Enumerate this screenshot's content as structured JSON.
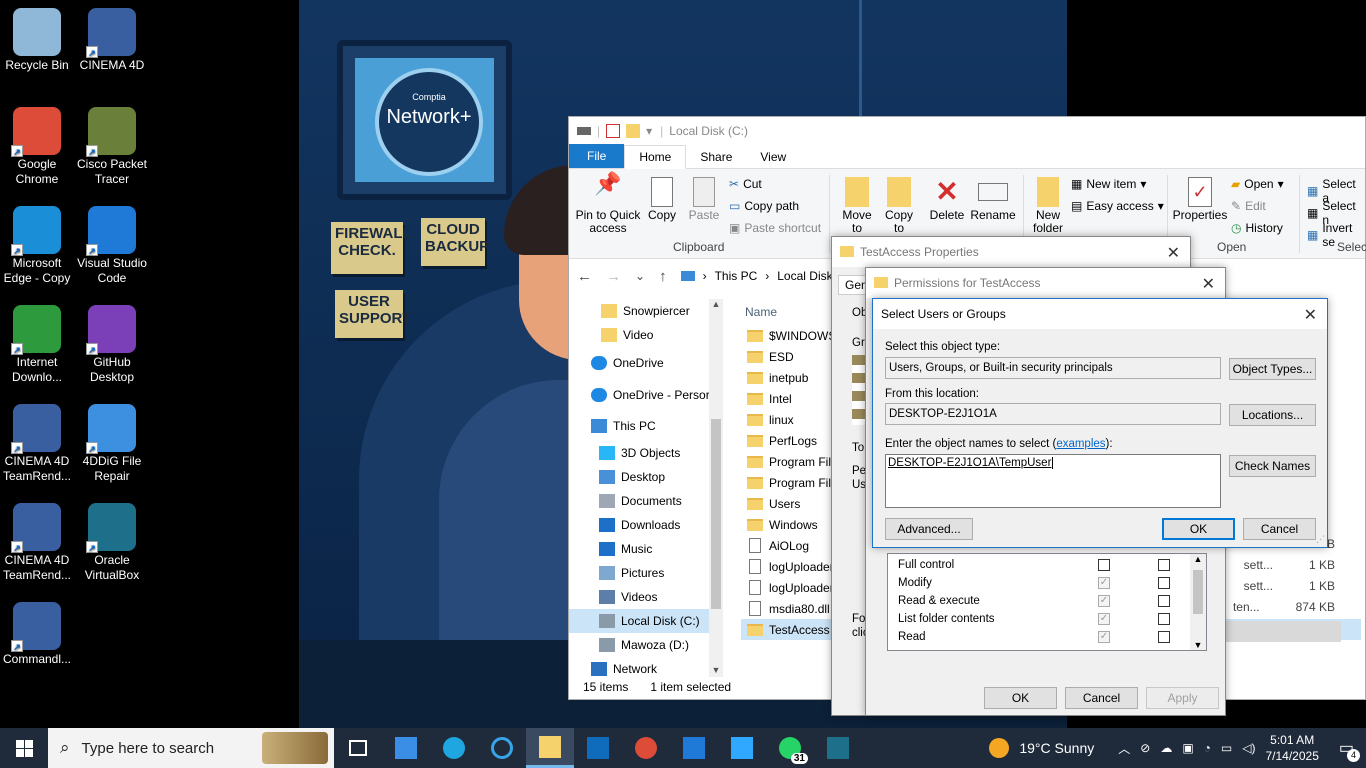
{
  "desktop": {
    "icons": [
      {
        "label": "Recycle Bin",
        "color": "#8fb8d8"
      },
      {
        "label": "CINEMA 4D",
        "color": "#3a5fa0"
      },
      {
        "label": "Google Chrome",
        "color": "#dd4b39"
      },
      {
        "label": "Cisco Packet Tracer",
        "color": "#6a7f3a"
      },
      {
        "label": "Microsoft Edge - Copy",
        "color": "#1a8fd8"
      },
      {
        "label": "Visual Studio Code",
        "color": "#1e7ad6"
      },
      {
        "label": "Internet Downlo...",
        "color": "#2e9a3e"
      },
      {
        "label": "GitHub Desktop",
        "color": "#7b3fb8"
      },
      {
        "label": "CINEMA 4D TeamRend...",
        "color": "#3a5fa0"
      },
      {
        "label": "4DDiG File Repair",
        "color": "#3d8fe0"
      },
      {
        "label": "CINEMA 4D TeamRend...",
        "color": "#3a5fa0"
      },
      {
        "label": "Oracle VirtualBox",
        "color": "#1d6f8a"
      },
      {
        "label": "Commandl...",
        "color": "#3a5fa0"
      }
    ]
  },
  "wallpaper": {
    "badge_small": "Comptia",
    "badge_big": "Network+",
    "notes": [
      "FIREWALL CHECK.",
      "CLOUD BACKUP",
      "USER SUPPORT"
    ]
  },
  "explorer": {
    "title": "Local Disk (C:)",
    "tabs": [
      "File",
      "Home",
      "Share",
      "View"
    ],
    "ribbon": {
      "pin": "Pin to Quick access",
      "copy": "Copy",
      "paste": "Paste",
      "cut": "Cut",
      "copy_path": "Copy path",
      "paste_shortcut": "Paste shortcut",
      "clipboard_group": "Clipboard",
      "move_to": "Move to",
      "copy_to": "Copy to",
      "delete": "Delete",
      "rename": "Rename",
      "new_folder": "New folder",
      "new_item": "New item",
      "easy_access": "Easy access",
      "properties": "Properties",
      "open": "Open",
      "edit": "Edit",
      "history": "History",
      "open_group": "Open",
      "select_all": "Select a",
      "select_none": "Select n",
      "invert_selection": "Invert se",
      "select_group": "Selec"
    },
    "breadcrumb": [
      "This PC",
      "Local Disk"
    ],
    "nav_items": [
      {
        "label": "Snowpiercer",
        "type": "folder"
      },
      {
        "label": "Video",
        "type": "folder"
      },
      {
        "label": "OneDrive",
        "type": "cloud"
      },
      {
        "label": "OneDrive - Persor",
        "type": "cloud"
      },
      {
        "label": "This PC",
        "type": "pc"
      },
      {
        "label": "3D Objects",
        "type": "3d"
      },
      {
        "label": "Desktop",
        "type": "desktop"
      },
      {
        "label": "Documents",
        "type": "docs"
      },
      {
        "label": "Downloads",
        "type": "downloads"
      },
      {
        "label": "Music",
        "type": "music"
      },
      {
        "label": "Pictures",
        "type": "pictures"
      },
      {
        "label": "Videos",
        "type": "videos"
      },
      {
        "label": "Local Disk (C:)",
        "type": "drive"
      },
      {
        "label": "Mawoza (D:)",
        "type": "drive"
      },
      {
        "label": "Network",
        "type": "network"
      }
    ],
    "column_name": "Name",
    "files": [
      {
        "name": "$WINDOWS.",
        "type": "folder"
      },
      {
        "name": "ESD",
        "type": "folder"
      },
      {
        "name": "inetpub",
        "type": "folder"
      },
      {
        "name": "Intel",
        "type": "folder"
      },
      {
        "name": "linux",
        "type": "folder"
      },
      {
        "name": "PerfLogs",
        "type": "folder"
      },
      {
        "name": "Program File",
        "type": "folder"
      },
      {
        "name": "Program File",
        "type": "folder"
      },
      {
        "name": "Users",
        "type": "folder"
      },
      {
        "name": "Windows",
        "type": "folder"
      },
      {
        "name": "AiOLog",
        "type": "file"
      },
      {
        "name": "logUploader",
        "type": "file"
      },
      {
        "name": "logUploader",
        "type": "file"
      },
      {
        "name": "msdia80.dll",
        "type": "file"
      },
      {
        "name": "TestAccess",
        "type": "folder"
      }
    ],
    "sizes": [
      "3 KB",
      "1 KB",
      "1 KB",
      "874 KB"
    ],
    "size_fragments": [
      "sett...",
      "sett...",
      "ten..."
    ],
    "status_items": "15 items",
    "status_selected": "1 item selected"
  },
  "properties_dialog": {
    "title": "TestAccess Properties",
    "tab_fragment": "Gen",
    "fragments": [
      "Ob",
      "Gr",
      "To",
      "Pe",
      "Us",
      "Fo",
      "clic"
    ]
  },
  "permissions_dialog": {
    "title": "Permissions for TestAccess",
    "permissions": [
      {
        "label": "Full control",
        "allow": false,
        "deny": false
      },
      {
        "label": "Modify",
        "allow": true,
        "deny": false
      },
      {
        "label": "Read & execute",
        "allow": true,
        "deny": false
      },
      {
        "label": "List folder contents",
        "allow": true,
        "deny": false
      },
      {
        "label": "Read",
        "allow": true,
        "deny": false
      }
    ],
    "ok": "OK",
    "cancel": "Cancel",
    "apply": "Apply"
  },
  "select_dialog": {
    "title": "Select Users or Groups",
    "object_type_label": "Select this object type:",
    "object_type_value": "Users, Groups, or Built-in security principals",
    "object_types_button": "Object Types...",
    "location_label": "From this location:",
    "location_value": "DESKTOP-E2J1O1A",
    "locations_button": "Locations...",
    "names_label_pre": "Enter the object names to select (",
    "names_label_link": "examples",
    "names_label_post": "):",
    "names_value": "DESKTOP-E2J1O1A\\TempUser",
    "check_names_button": "Check Names",
    "advanced_button": "Advanced...",
    "ok_button": "OK",
    "cancel_button": "Cancel"
  },
  "taskbar": {
    "search_placeholder": "Type here to search",
    "apps": [
      "task-view",
      "store",
      "edge",
      "cortana",
      "file-explorer",
      "outlook",
      "chrome",
      "vscode",
      "photoshop",
      "whatsapp",
      "virtualbox"
    ],
    "whatsapp_badge": "31",
    "weather": "19°C  Sunny",
    "time": "5:01 AM",
    "date": "7/14/2025",
    "notifications": "4"
  }
}
